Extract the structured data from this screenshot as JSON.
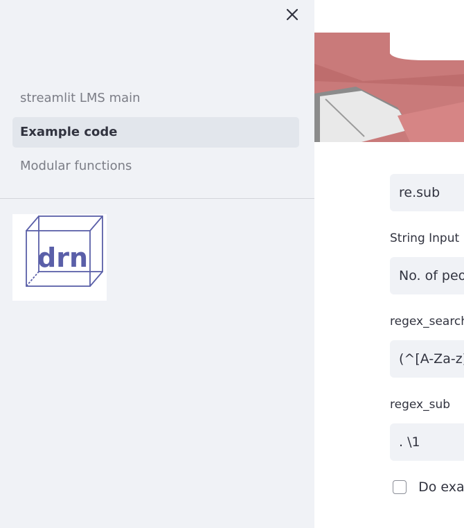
{
  "sidebar": {
    "close_icon": "close-icon",
    "nav_items": [
      {
        "label": "streamlit LMS main",
        "active": false
      },
      {
        "label": "Example code",
        "active": true
      },
      {
        "label": "Modular functions",
        "active": false
      }
    ],
    "logo": {
      "text": "drn",
      "description_icon": "cube-logo"
    }
  },
  "main": {
    "method_select": {
      "value": "re.sub"
    },
    "string_input": {
      "label": "String Input",
      "value": "No. of peop"
    },
    "regex_search": {
      "label": "regex_search",
      "value": "(^[A-Za-z])"
    },
    "regex_sub": {
      "label": "regex_sub",
      "value": ". \\1"
    },
    "checkbox": {
      "label": "Do exar",
      "checked": false
    }
  },
  "colors": {
    "sidebar_bg": "#f0f2f6",
    "active_bg": "#e2e6ec",
    "text": "#31333f",
    "muted_text": "#7b7d86",
    "banner_red": "#c97a7a"
  }
}
